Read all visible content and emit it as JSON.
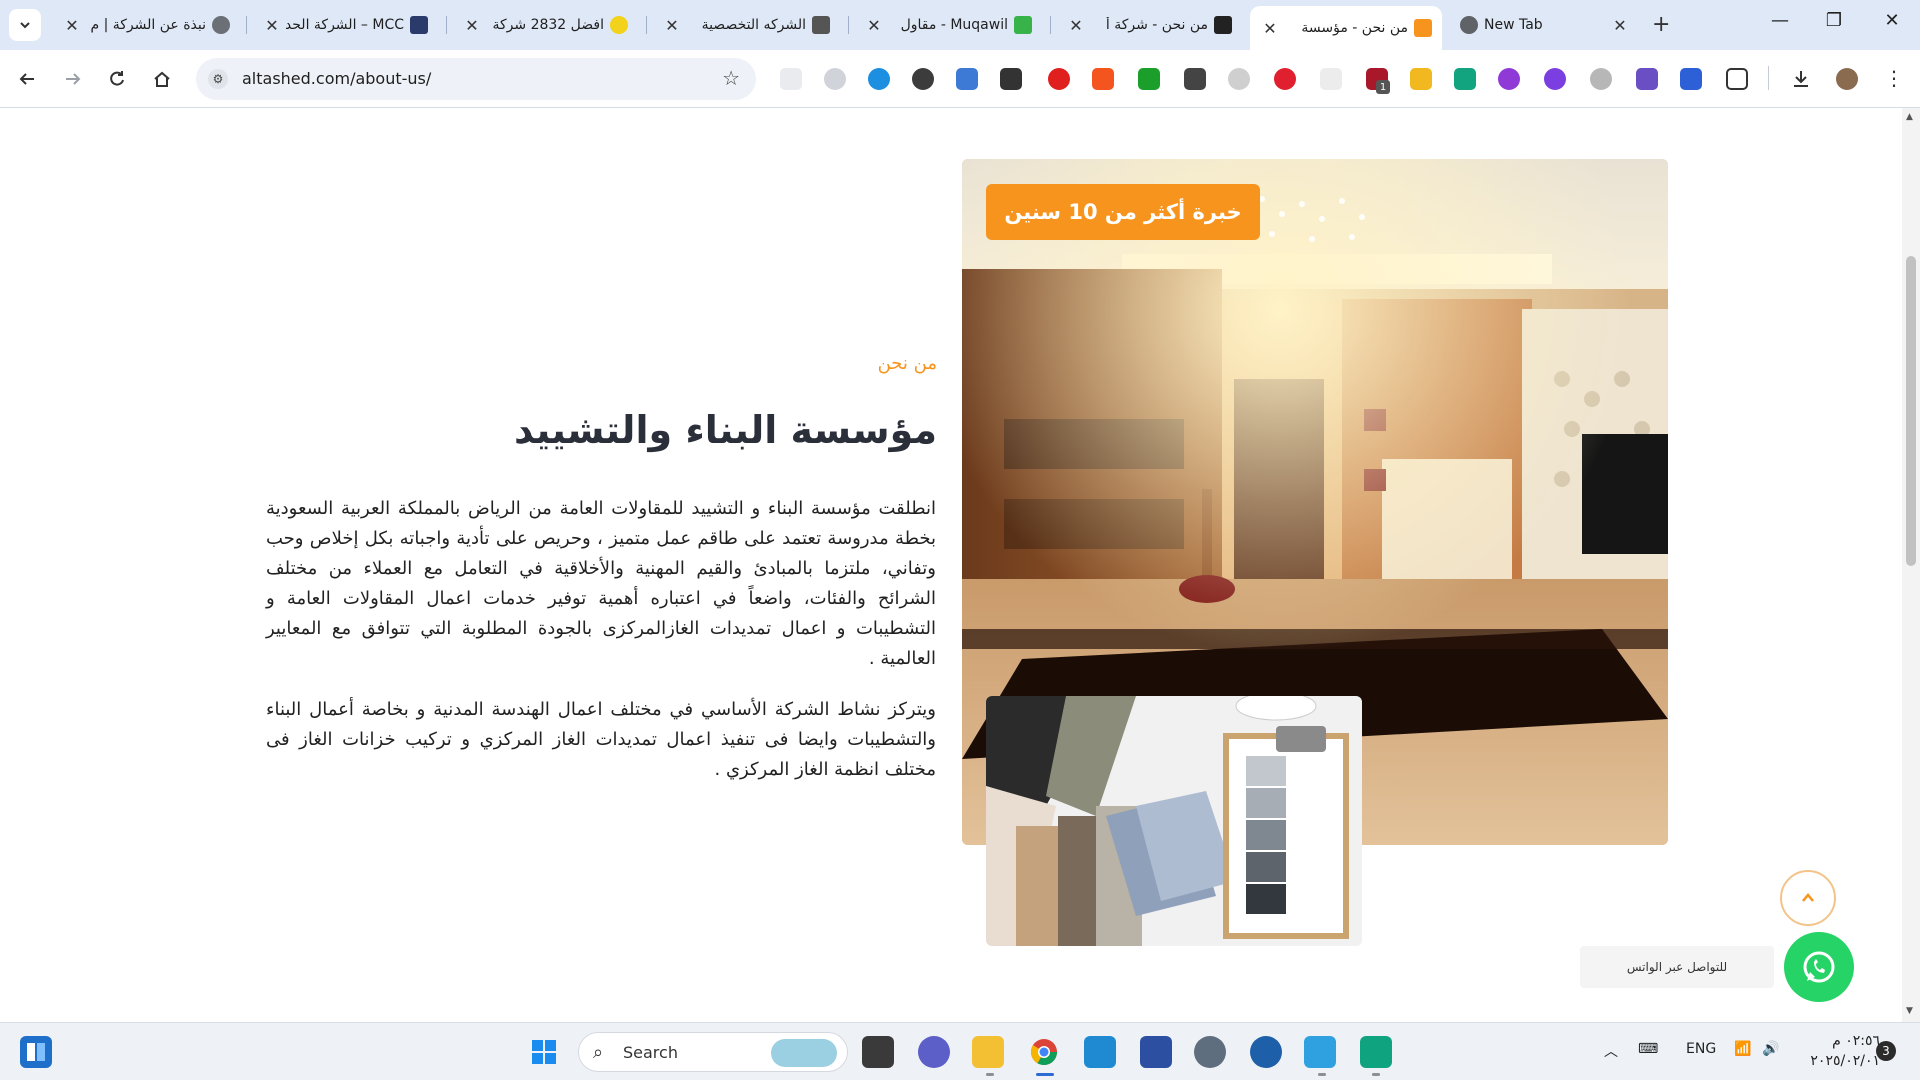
{
  "browser": {
    "tabs": [
      {
        "title": "نبذة عن الشركة | م",
        "active": false
      },
      {
        "title": "MCC – الشركة الحديثة",
        "active": false
      },
      {
        "title": "افضل 2832 شركة",
        "active": false
      },
      {
        "title": "الشركه التخصصية",
        "active": false
      },
      {
        "title": "Muqawil - مقاول",
        "active": false
      },
      {
        "title": "من نحن - شركة أ",
        "active": false
      },
      {
        "title": "من نحن - مؤسسة",
        "active": true
      },
      {
        "title": "New Tab",
        "active": false
      }
    ],
    "url": "altashed.com/about-us/",
    "extension_badge": "1"
  },
  "page": {
    "experience_badge": "خبرة أكثر من 10 سنين",
    "section_label": "من نحن",
    "title": "مؤسسة البناء والتشييد",
    "paragraph_1": "انطلقت مؤسسة البناء و التشييد للمقاولات العامة من الرياض بالمملكة العربية السعودية بخطة مدروسة تعتمد على طاقم عمل متميز ، وحريص على تأدية واجباته بكل إخلاص وحب وتفاني، ملتزما بالمبادئ والقيم المهنية والأخلاقية في التعامل مع العملاء من مختلف الشرائح والفئات، واضعاً في اعتباره أهمية توفير خدمات اعمال المقاولات العامة و التشطيبات و اعمال تمديدات الغازالمركزى بالجودة المطلوبة التي تتوافق مع المعايير العالمية .",
    "paragraph_2": "ويتركز نشاط الشركة الأساسي في مختلف اعمال الهندسة المدنية و بخاصة أعمال البناء والتشطيبات وايضا فى  تنفيذ اعمال تمديدات الغاز المركزي و تركيب خزانات الغاز فى مختلف انظمة الغاز المركزي .",
    "whatsapp_label": "للتواصل عبر الواتس"
  },
  "taskbar": {
    "search_placeholder": "Search",
    "language": "ENG",
    "time": "٠٢:٥٦ م",
    "date": "٢٠٢٥/٠٢/٠١",
    "notifications": "3"
  },
  "colors": {
    "accent_orange": "#f7941d",
    "whatsapp_green": "#25d366",
    "title_dark": "#2b2f3a"
  }
}
